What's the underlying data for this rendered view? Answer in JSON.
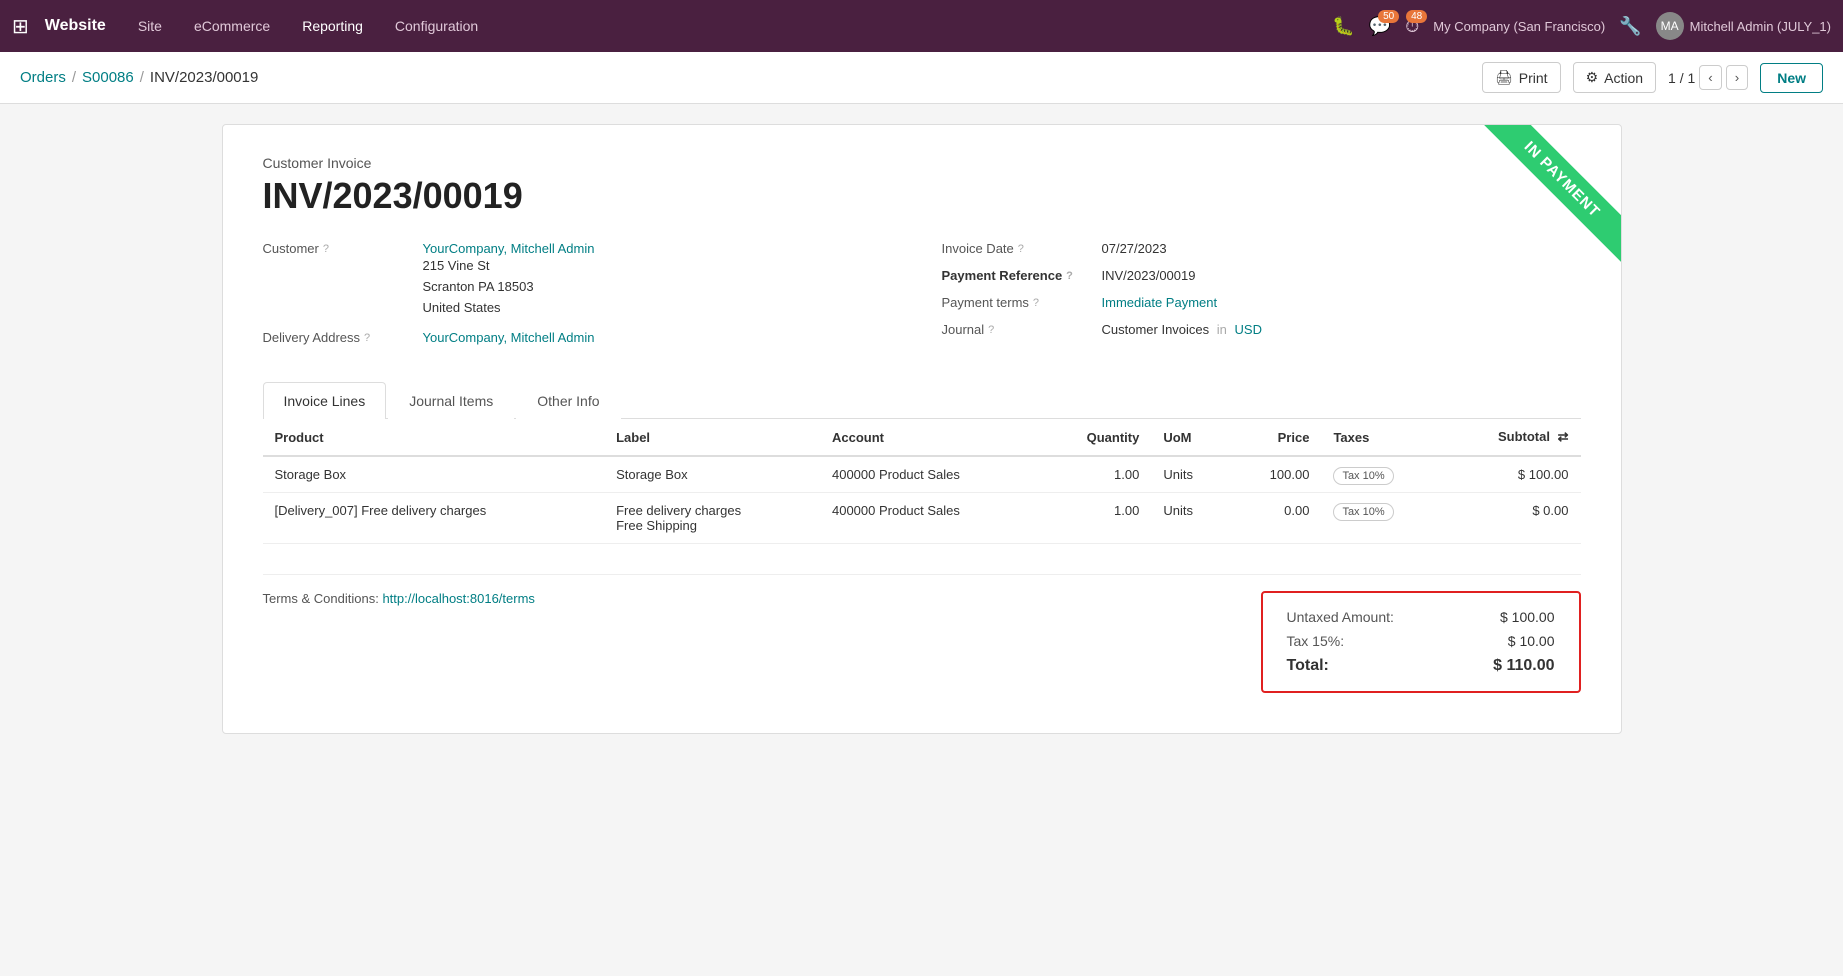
{
  "topNav": {
    "brand": "Website",
    "items": [
      "Site",
      "eCommerce",
      "Reporting",
      "Configuration"
    ],
    "activeItem": "Reporting",
    "company": "My Company (San Francisco)",
    "user": "Mitchell Admin (JULY_1)",
    "chatBadge": "50",
    "clockBadge": "48"
  },
  "breadcrumb": {
    "parts": [
      "Orders",
      "S00086",
      "INV/2023/00019"
    ],
    "printLabel": "Print",
    "actionLabel": "Action",
    "pageInfo": "1 / 1",
    "newLabel": "New"
  },
  "invoice": {
    "type": "Customer Invoice",
    "number": "INV/2023/00019",
    "ribbon": "IN PAYMENT",
    "customer": {
      "label": "Customer",
      "name": "YourCompany, Mitchell Admin",
      "address": "215 Vine St\nScranton PA 18503\nUnited States"
    },
    "deliveryAddress": {
      "label": "Delivery Address",
      "name": "YourCompany, Mitchell Admin"
    },
    "invoiceDate": {
      "label": "Invoice Date",
      "value": "07/27/2023"
    },
    "paymentReference": {
      "label": "Payment Reference",
      "value": "INV/2023/00019"
    },
    "paymentTerms": {
      "label": "Payment terms",
      "value": "Immediate Payment"
    },
    "journal": {
      "label": "Journal",
      "value": "Customer Invoices",
      "inLabel": "in",
      "currency": "USD"
    },
    "tabs": [
      {
        "id": "invoice-lines",
        "label": "Invoice Lines",
        "active": true
      },
      {
        "id": "journal-items",
        "label": "Journal Items",
        "active": false
      },
      {
        "id": "other-info",
        "label": "Other Info",
        "active": false
      }
    ],
    "table": {
      "columns": [
        "Product",
        "Label",
        "Account",
        "Quantity",
        "UoM",
        "Price",
        "Taxes",
        "Subtotal"
      ],
      "rows": [
        {
          "product": "Storage Box",
          "label": "Storage Box",
          "account": "400000 Product Sales",
          "quantity": "1.00",
          "uom": "Units",
          "price": "100.00",
          "taxes": "Tax 10%",
          "subtotal": "$ 100.00"
        },
        {
          "product": "[Delivery_007] Free delivery charges",
          "label": "Free delivery charges\nFree Shipping",
          "account": "400000 Product Sales",
          "quantity": "1.00",
          "uom": "Units",
          "price": "0.00",
          "taxes": "Tax 10%",
          "subtotal": "$ 0.00"
        }
      ]
    },
    "footer": {
      "termsLabel": "Terms & Conditions:",
      "termsLink": "http://localhost:8016/terms",
      "totals": {
        "untaxedLabel": "Untaxed Amount:",
        "untaxedValue": "$ 100.00",
        "taxLabel": "Tax 15%:",
        "taxValue": "$ 10.00",
        "totalLabel": "Total:",
        "totalValue": "$ 110.00"
      }
    }
  }
}
